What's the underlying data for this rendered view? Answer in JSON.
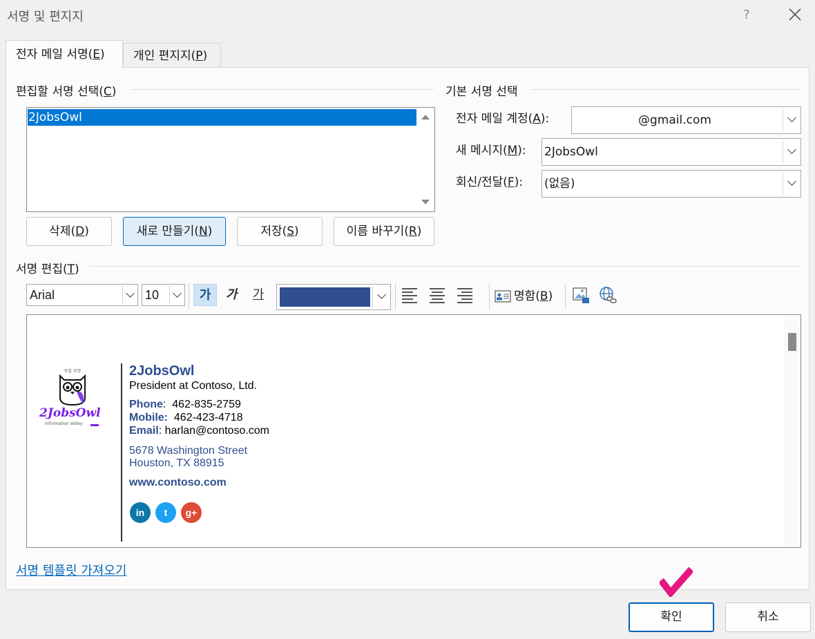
{
  "window": {
    "title": "서명 및 편지지",
    "help": "?"
  },
  "tabs": [
    {
      "label": "전자 메일 서명(",
      "accel": "E",
      "suffix": ")",
      "active": true
    },
    {
      "label": "개인 편지지(",
      "accel": "P",
      "suffix": ")",
      "active": false
    }
  ],
  "select_section": {
    "label": "편집할 서명 선택(",
    "accel": "C",
    "suffix": ")",
    "signatures": [
      "2JobsOwl"
    ],
    "selected": "2JobsOwl"
  },
  "list_buttons": [
    {
      "label": "삭제(",
      "accel": "D",
      "suffix": ")"
    },
    {
      "label": "새로 만들기(",
      "accel": "N",
      "suffix": ")"
    },
    {
      "label": "저장(",
      "accel": "S",
      "suffix": ")"
    },
    {
      "label": "이름 바꾸기(",
      "accel": "R",
      "suffix": ")"
    }
  ],
  "default_section": {
    "label": "기본 서명 선택",
    "account": {
      "label": "전자 메일 계정(",
      "accel": "A",
      "suffix": "):",
      "value": "@gmail.com"
    },
    "new_messages": {
      "label": "새 메시지(",
      "accel": "M",
      "suffix": "):",
      "value": "2JobsOwl"
    },
    "replies": {
      "label": "회신/전달(",
      "accel": "F",
      "suffix": "):",
      "value": "(없음)"
    }
  },
  "edit_section": {
    "label": "서명 편집(",
    "accel": "T",
    "suffix": ")"
  },
  "toolbar": {
    "font": "Arial",
    "size": "10",
    "bold_glyph": "가",
    "italic_glyph": "가",
    "underline_glyph": "가",
    "font_color": "#2f4f8f",
    "business_card": {
      "label": "명함(",
      "accel": "B",
      "suffix": ")"
    }
  },
  "signature_content": {
    "logo_text": "2JobsOwl",
    "logo_tag": "Information Valley",
    "logo_top": "투잡 부엉",
    "name": "2JobsOwl",
    "title": "President at Contoso, Ltd.",
    "phone_label": "Phone",
    "phone": "462-835-2759",
    "mobile_label": "Mobile:",
    "mobile": "462-423-4718",
    "email_label": "Email",
    "email": "harlan@contoso.com",
    "address1": "5678  Washington  Street",
    "address2": "Houston,  TX  88915",
    "website": "www.contoso.com",
    "social": [
      {
        "icon": "linkedin-icon",
        "glyph": "in",
        "color": "#0e76a8"
      },
      {
        "icon": "twitter-icon",
        "glyph": "t",
        "color": "#1da1f2"
      },
      {
        "icon": "google-plus-icon",
        "glyph": "g+",
        "color": "#dd4b39"
      }
    ]
  },
  "template_link": "서명 템플릿 가져오기",
  "footer": {
    "ok": "확인",
    "cancel": "취소"
  }
}
